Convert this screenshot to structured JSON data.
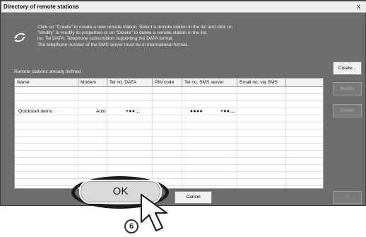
{
  "window": {
    "title": "Directory of remote stations",
    "close_glyph": "x"
  },
  "info": {
    "icon": "info-arrow-icon",
    "lines": [
      "Click on \"Create\" to create a new remote station. Select a remote station in the list and click on",
      "\"Modify\" to modify its properties or on \"Delete\" to delete a remote station in the list.",
      "no. Tel DATA: Telephone subscription supporting the DATA format.",
      "The telephone number of the SMS server must be in international format."
    ]
  },
  "list": {
    "label": "Remote stations already defined",
    "columns": [
      "Name",
      "Modem",
      "Tel no. DATA",
      "PIN code",
      "Tel no. SMS server",
      "Email no. via SMS"
    ],
    "rows": [
      {
        "name": "Quickstart demo",
        "modem": "Auto",
        "tel_data": "+●●...",
        "pin": "",
        "sms_server": "●●●●",
        "email_sms": "+●●..."
      }
    ]
  },
  "buttons": {
    "create": "Create...",
    "modify": "Modify",
    "delete": "Delete",
    "ok": "OK",
    "cancel": "Cancel",
    "help": "?"
  },
  "annotation": {
    "step": "6"
  },
  "colors": {
    "dialog_bg": "#6d6d6d",
    "title_bar": "#eeeeee",
    "highlight_ring": "#1a1a1a"
  }
}
